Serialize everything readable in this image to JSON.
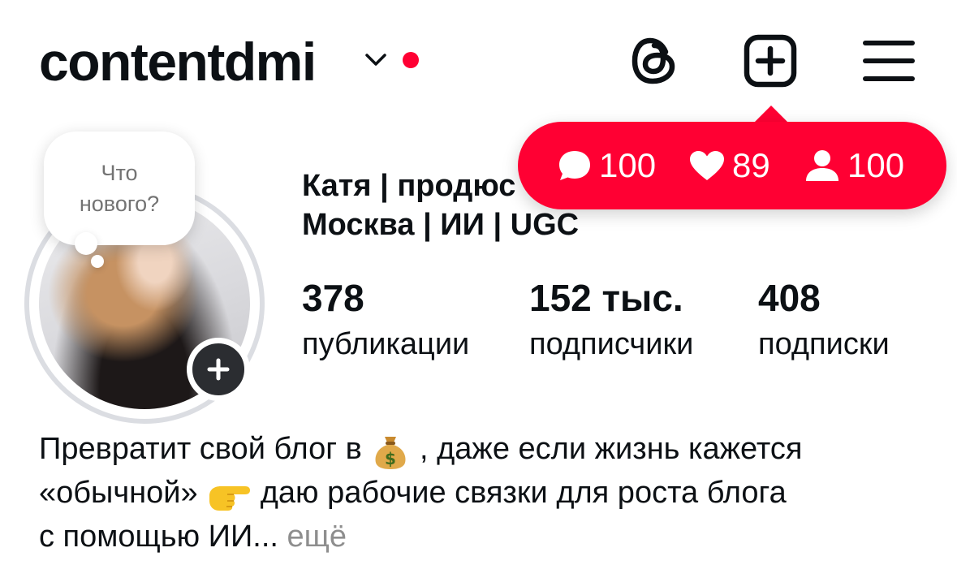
{
  "header": {
    "username": "contentdmi",
    "icons": [
      "chevron-down-icon",
      "threads-icon",
      "create-post-icon",
      "menu-icon"
    ]
  },
  "notifications": {
    "comments": "100",
    "likes": "89",
    "follows": "100"
  },
  "thought_bubble": {
    "line1": "Что",
    "line2": "нового?"
  },
  "profile": {
    "display_name": "Катя | продюс",
    "location_line": "Москва | ИИ | UGC"
  },
  "stats": [
    {
      "value": "378",
      "label": "публикации"
    },
    {
      "value": "152 тыс.",
      "label": "подписчики"
    },
    {
      "value": "408",
      "label": "подписки"
    }
  ],
  "bio": {
    "line1_a": "Превратит свой блог в",
    "line1_b": ", даже если жизнь кажется",
    "line2_a": "«обычной»",
    "line2_b": "даю рабочие связки для роста блога",
    "line3": "с помощью ИИ...",
    "more": "ещё"
  },
  "colors": {
    "accent_red": "#ff0033",
    "text": "#0c1014",
    "muted": "#8e8e8e",
    "ring": "#dbdde2"
  }
}
